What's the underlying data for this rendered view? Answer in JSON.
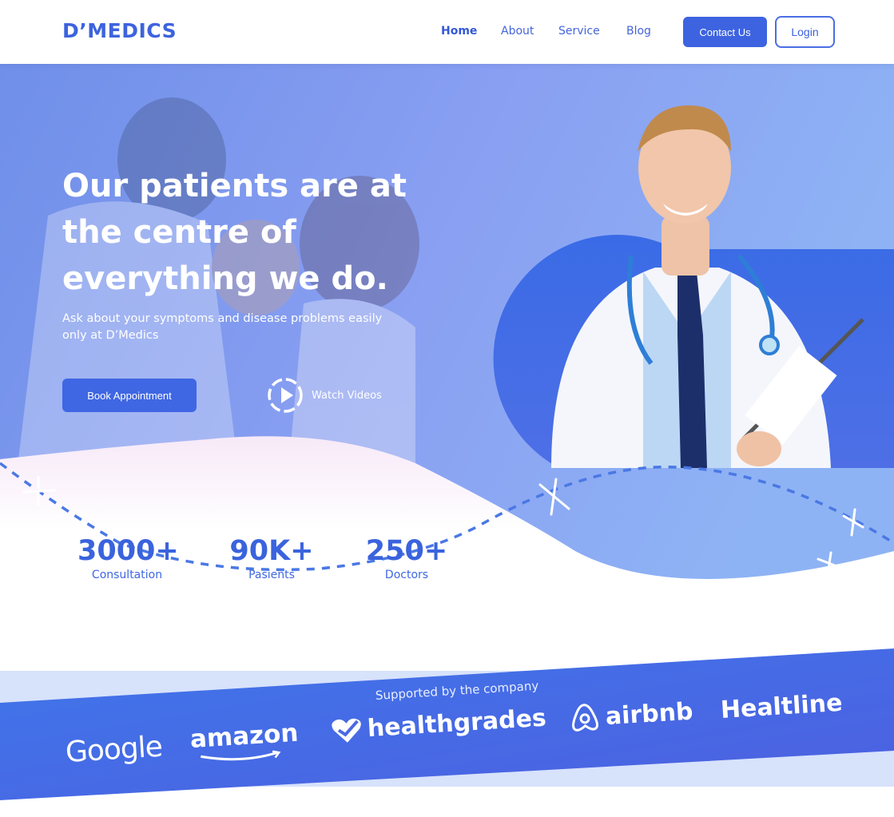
{
  "header": {
    "logo": "D’MEDICS",
    "nav": [
      "Home",
      "About",
      "Service",
      "Blog"
    ],
    "contact_label": "Contact Us",
    "login_label": "Login"
  },
  "hero": {
    "title": "Our patients are at the centre of everything we do.",
    "subtitle": "Ask about your symptoms and disease problems easily only at D’Medics",
    "book_label": "Book Appointment",
    "watch_label": "Watch Videos"
  },
  "stats": [
    {
      "value": "3000+",
      "label": "Consultation"
    },
    {
      "value": "90K+",
      "label": "Pasients"
    },
    {
      "value": "250+",
      "label": "Doctors"
    }
  ],
  "support": {
    "title": "Supported by the company",
    "brands": [
      "Google",
      "amazon",
      "healthgrades",
      "airbnb",
      "Healtline"
    ]
  },
  "colors": {
    "primary": "#3d63e0",
    "hero_blue": "#7e9cf0",
    "band_blue": "#3f6ee8"
  },
  "icons": {
    "play": "play-icon",
    "healthgrades": "heart-check-icon",
    "airbnb": "airbnb-icon"
  }
}
